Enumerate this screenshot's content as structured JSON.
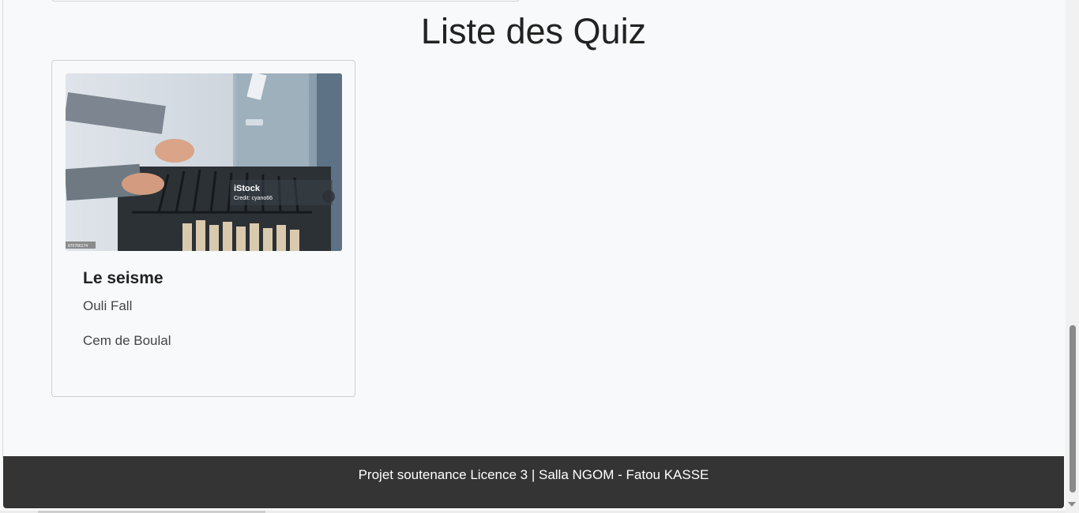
{
  "main": {
    "title": "Liste des Quiz"
  },
  "quizzes": [
    {
      "title": "Le seisme",
      "author": "Ouli Fall",
      "school": "Cem de Boulal",
      "image": {
        "watermark_brand": "iStock",
        "watermark_credit": "Credit: cyano66",
        "stock_id": "870766174"
      }
    }
  ],
  "footer": {
    "text": "Projet soutenance Licence 3 | Salla NGOM - Fatou KASSE"
  },
  "colors": {
    "footer_bg": "#343434",
    "page_bg": "#f8f9fa"
  }
}
